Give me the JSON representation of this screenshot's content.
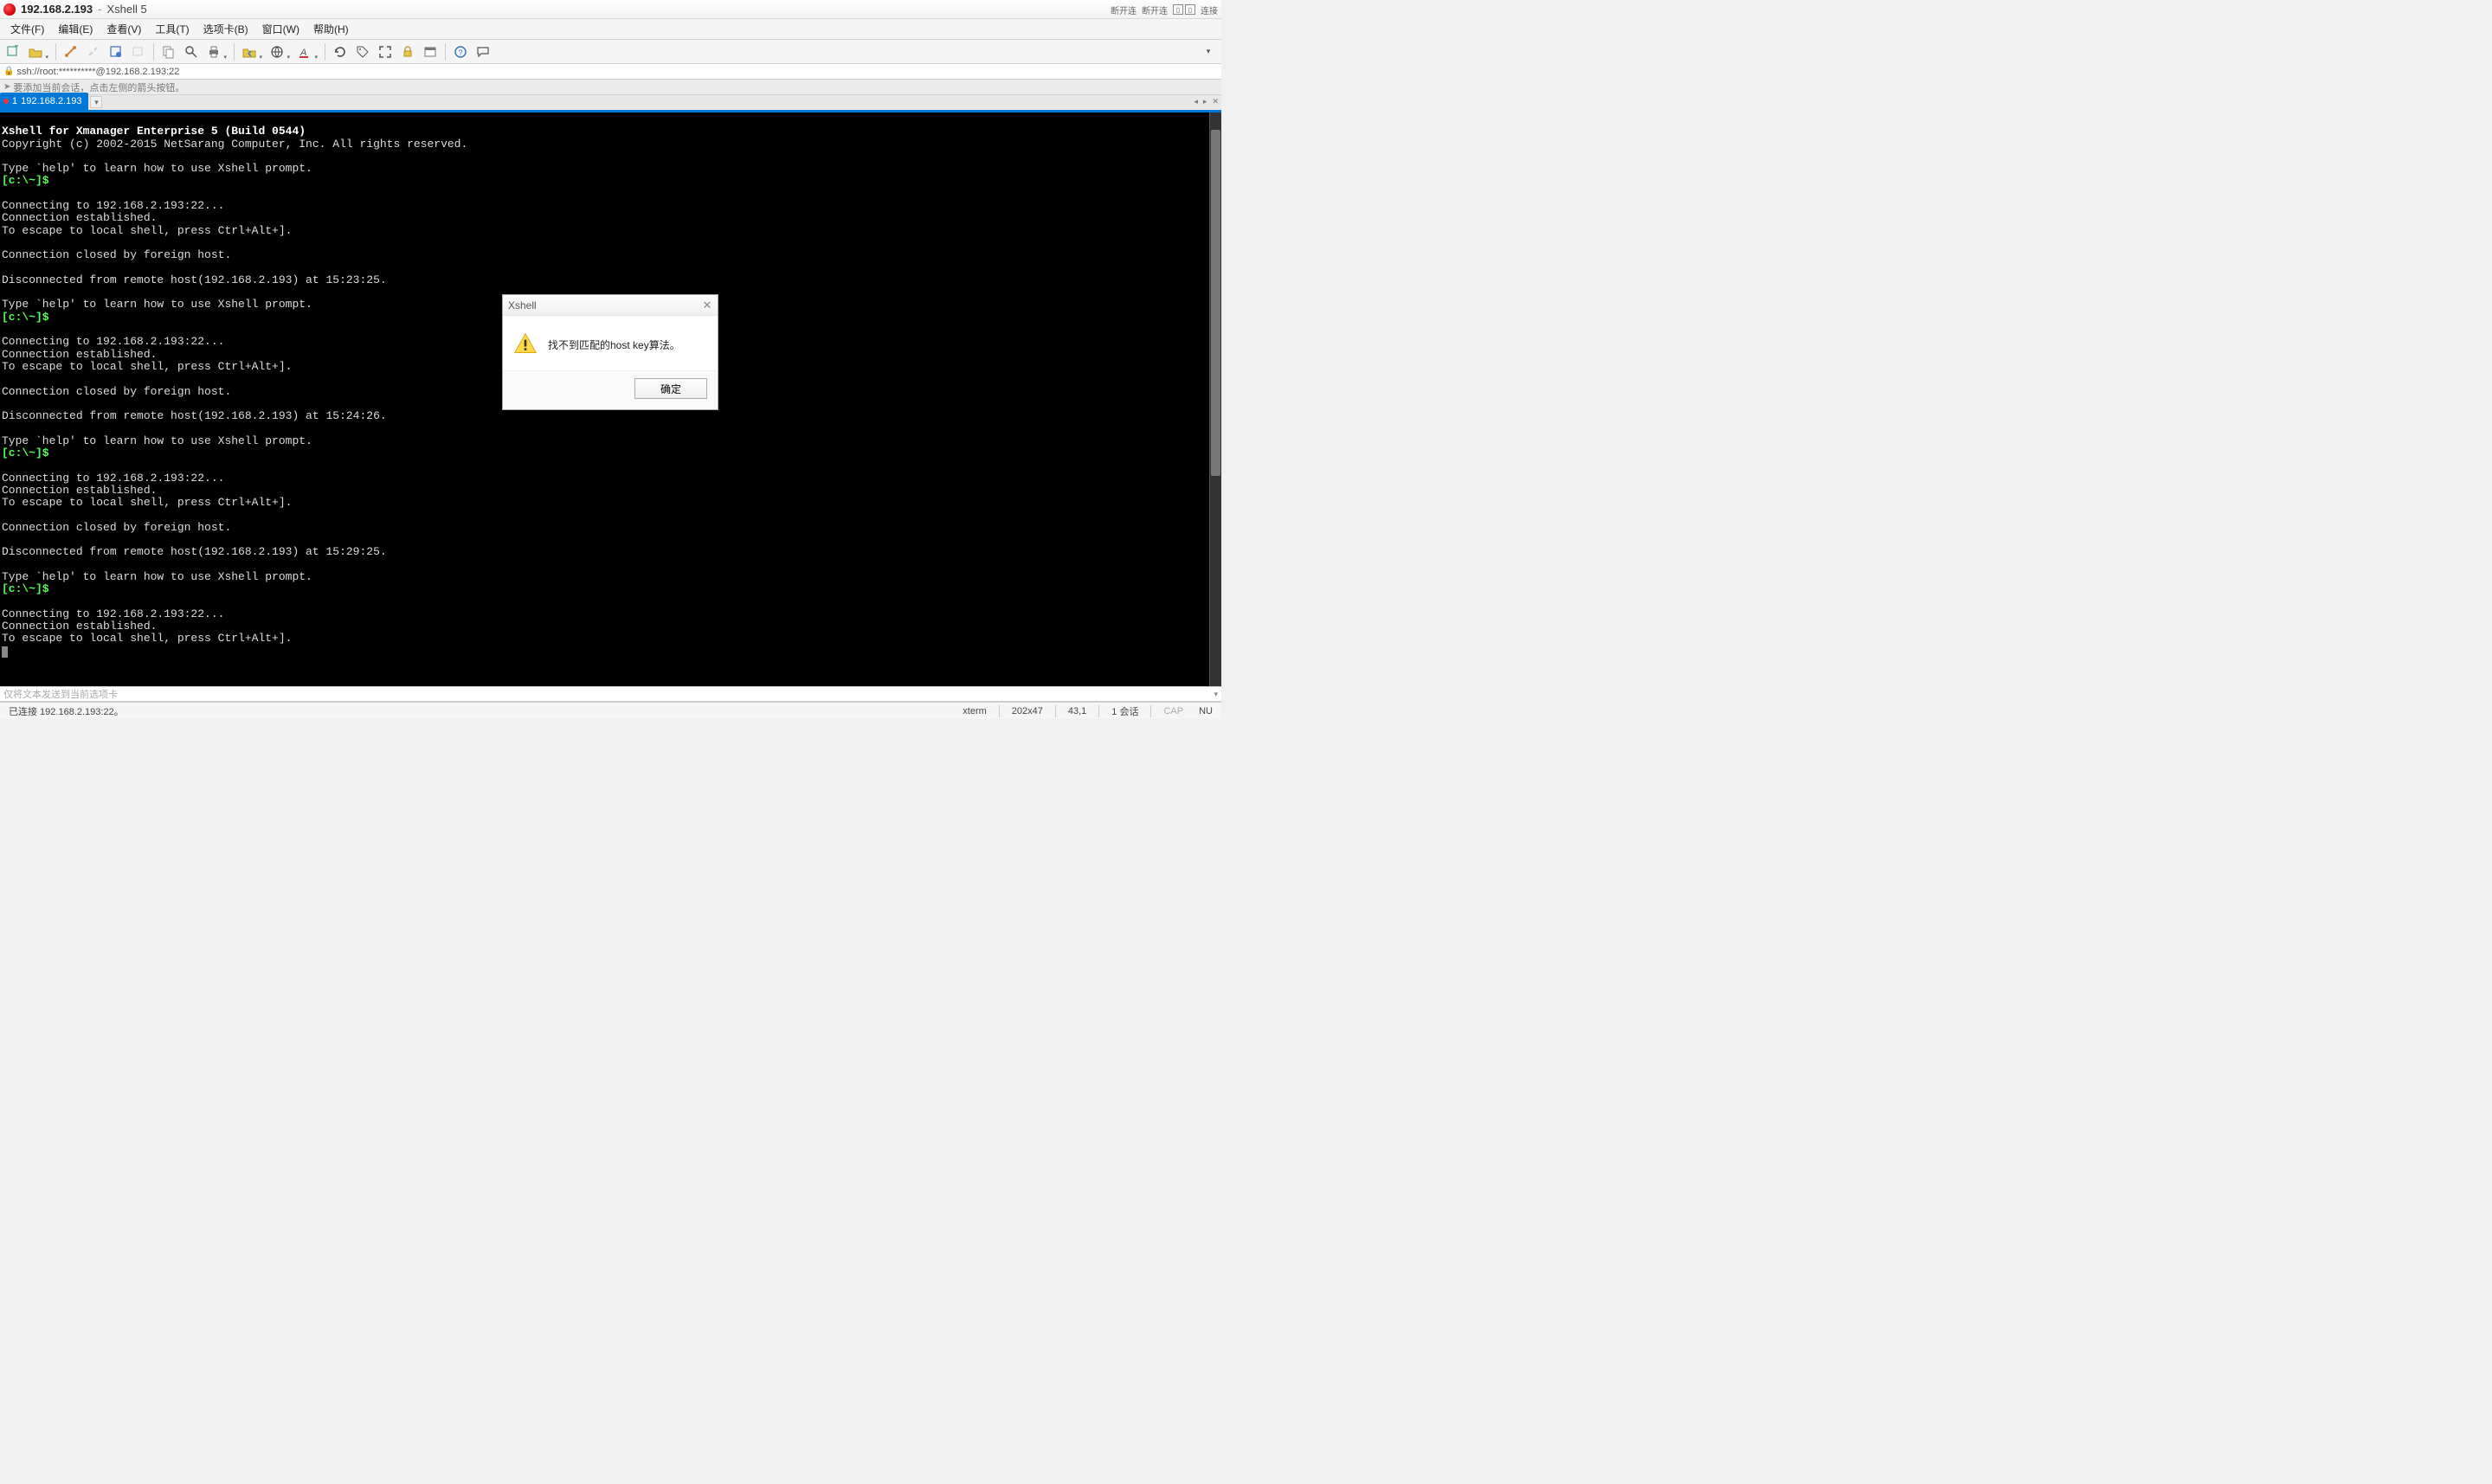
{
  "title": {
    "host": "192.168.2.193",
    "dash": "-",
    "app": "Xshell 5",
    "right1": "断开连",
    "right2": "断开连",
    "right3": "连接"
  },
  "menu": {
    "file": "文件(F)",
    "edit": "编辑(E)",
    "view": "查看(V)",
    "tools": "工具(T)",
    "tabs": "选项卡(B)",
    "window": "窗口(W)",
    "help": "帮助(H)"
  },
  "address_bar": "ssh://root:**********@192.168.2.193:22",
  "hint_bar": "要添加当前会话，点击左侧的箭头按钮。",
  "tab": {
    "index": "1",
    "label": "192.168.2.193",
    "add": "▾"
  },
  "terminal": {
    "line0": "Xshell for Xmanager Enterprise 5 (Build 0544)",
    "line1": "Copyright (c) 2002-2015 NetSarang Computer, Inc. All rights reserved.",
    "line2": "",
    "line3": "Type `help' to learn how to use Xshell prompt.",
    "prompt1": "[c:\\~]$",
    "line4": "",
    "line5": "Connecting to 192.168.2.193:22...",
    "line6": "Connection established.",
    "line7": "To escape to local shell, press Ctrl+Alt+].",
    "line8": "",
    "line9": "Connection closed by foreign host.",
    "line10": "",
    "line11": "Disconnected from remote host(192.168.2.193) at 15:23:25.",
    "line12": "",
    "line13": "Type `help' to learn how to use Xshell prompt.",
    "prompt2": "[c:\\~]$",
    "line14": "",
    "line15": "Connecting to 192.168.2.193:22...",
    "line16": "Connection established.",
    "line17": "To escape to local shell, press Ctrl+Alt+].",
    "line18": "",
    "line19": "Connection closed by foreign host.",
    "line20": "",
    "line21": "Disconnected from remote host(192.168.2.193) at 15:24:26.",
    "line22": "",
    "line23": "Type `help' to learn how to use Xshell prompt.",
    "prompt3": "[c:\\~]$",
    "line24": "",
    "line25": "Connecting to 192.168.2.193:22...",
    "line26": "Connection established.",
    "line27": "To escape to local shell, press Ctrl+Alt+].",
    "line28": "",
    "line29": "Connection closed by foreign host.",
    "line30": "",
    "line31": "Disconnected from remote host(192.168.2.193) at 15:29:25.",
    "line32": "",
    "line33": "Type `help' to learn how to use Xshell prompt.",
    "prompt4": "[c:\\~]$",
    "line34": "",
    "line35": "Connecting to 192.168.2.193:22...",
    "line36": "Connection established.",
    "line37": "To escape to local shell, press Ctrl+Alt+]."
  },
  "send_bar": "仅将文本发送到当前选项卡",
  "status": {
    "left": "已连接 192.168.2.193:22。",
    "term": "xterm",
    "dims": "202x47",
    "pos": "43,1",
    "sessions": "1 会话",
    "caps": "CAP",
    "num": "NU"
  },
  "modal": {
    "title": "Xshell",
    "text": "找不到匹配的host key算法。",
    "ok": "确定"
  }
}
